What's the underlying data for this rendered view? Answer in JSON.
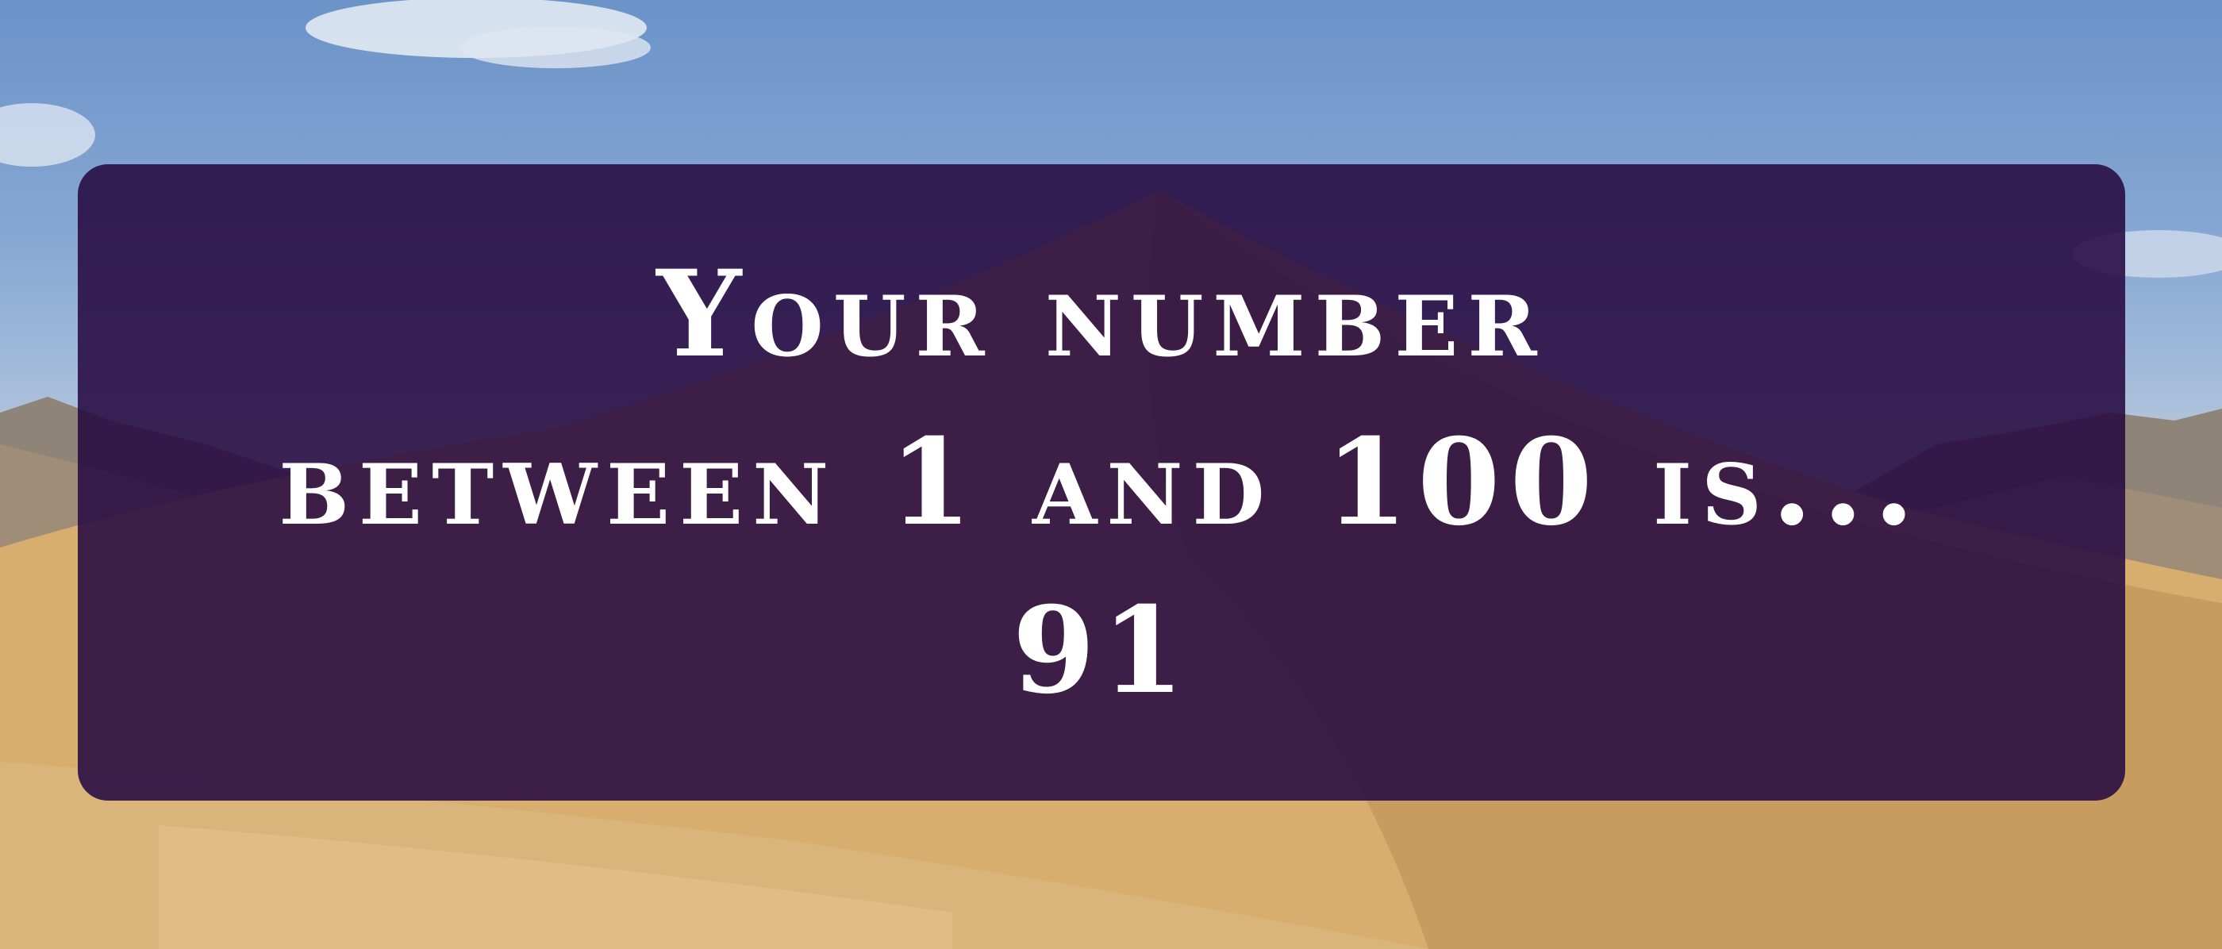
{
  "result_card": {
    "line1": "Your number",
    "line2": "between 1 and 100 is...",
    "number": "91"
  },
  "colors": {
    "card_background": "#2a0c44",
    "text": "#ffffff",
    "sky": "#7a9fd0",
    "sand": "#d3ad70"
  }
}
